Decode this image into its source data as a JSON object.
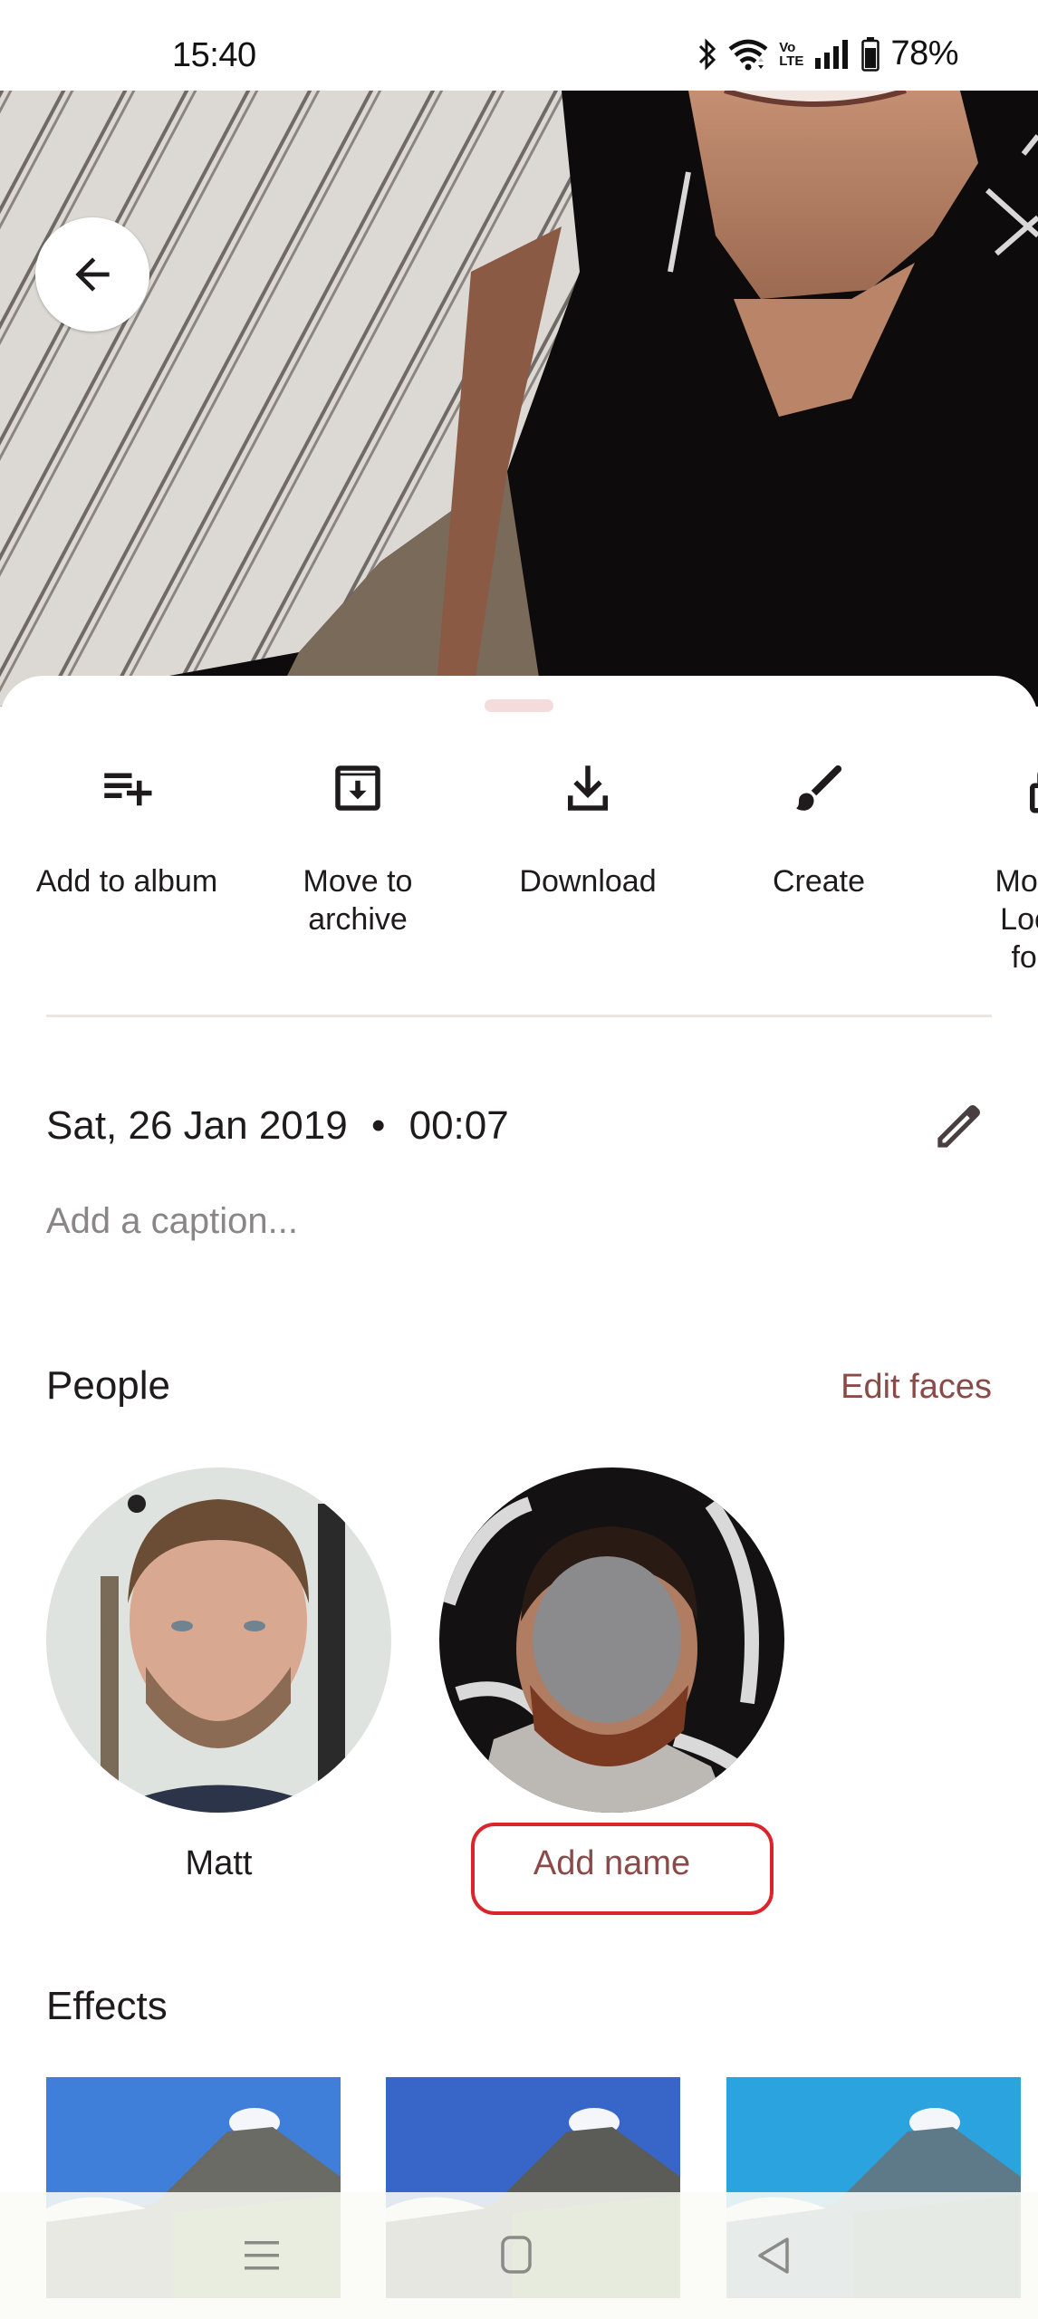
{
  "status_bar": {
    "time": "15:40",
    "battery_percent": "78%",
    "icons": [
      "bluetooth-icon",
      "wifi-icon",
      "volte-icon",
      "signal-icon",
      "battery-icon"
    ],
    "volte_label_top": "Vo",
    "volte_label_bottom": "LTE"
  },
  "photo": {
    "back_button_icon": "arrow-back-icon"
  },
  "actions": [
    {
      "label": "Add to album",
      "icon": "playlist-add-icon"
    },
    {
      "label": "Move to archive",
      "icon": "archive-icon"
    },
    {
      "label": "Download",
      "icon": "download-icon"
    },
    {
      "label": "Create",
      "icon": "brush-icon"
    },
    {
      "label": "Move to Locked folder",
      "icon": "lock-folder-icon"
    }
  ],
  "details": {
    "date": "Sat, 26 Jan 2019",
    "separator": "•",
    "time": "00:07",
    "edit_icon": "pencil-icon",
    "caption_placeholder": "Add a caption..."
  },
  "people": {
    "title": "People",
    "edit_faces_label": "Edit faces",
    "persons": [
      {
        "name": "Matt"
      },
      {
        "name": "Add name"
      }
    ]
  },
  "effects": {
    "title": "Effects",
    "thumbnails": [
      "effect-1",
      "effect-2",
      "effect-3"
    ]
  },
  "nav_bar": {
    "buttons": [
      "recents-icon",
      "home-icon",
      "back-icon"
    ]
  },
  "colors": {
    "accent": "#8a4b48",
    "highlight": "#d9252b",
    "text": "#1f1a1b",
    "muted": "#8a8586"
  }
}
